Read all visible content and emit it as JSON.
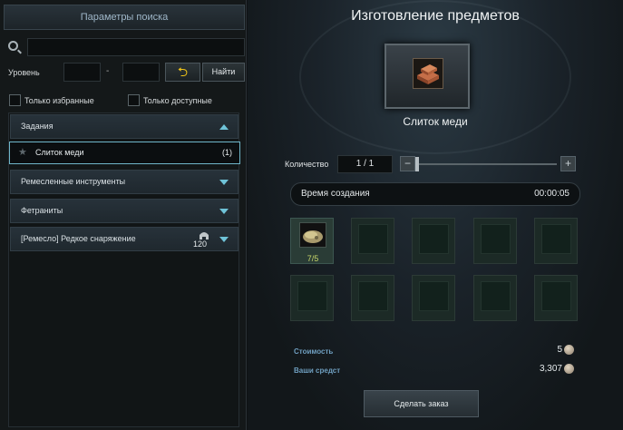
{
  "search_panel": {
    "title": "Параметры поиска",
    "search": {
      "value": "",
      "placeholder": ""
    },
    "level_label": "Уровень",
    "level_separator": "-",
    "level_min": "",
    "level_max": "",
    "find_button": "Найти",
    "only_favorites": "Только избранные",
    "only_available": "Только доступные",
    "categories": [
      {
        "label": "Задания",
        "expanded": true
      },
      {
        "label": "Ремесленные инструменты",
        "expanded": false
      },
      {
        "label": "Фетраниты",
        "expanded": false
      },
      {
        "label": "[Ремесло] Редкое снаряжение",
        "expanded": false,
        "level": "120"
      }
    ],
    "selected_item": {
      "name": "Слиток меди",
      "count": "(1)"
    }
  },
  "crafting": {
    "title": "Изготовление предметов",
    "product_name": "Слиток меди",
    "quantity_label": "Количество",
    "quantity_value": "1 / 1",
    "time_label": "Время создания",
    "time_value": "00:00:05",
    "material_count": "7/5",
    "cost_label": "Стоимость",
    "cost_value": "5",
    "funds_label": "Ваши средст",
    "funds_value": "3,307",
    "order_button": "Сделать заказ"
  },
  "icons": [
    "search-icon",
    "reset-icon",
    "star-icon",
    "chevron-up-icon",
    "chevron-down-icon",
    "helmet-icon",
    "copper-ingot-icon",
    "ore-icon",
    "coin-icon",
    "minus-icon",
    "plus-icon"
  ],
  "colors": {
    "accent": "#6fc3d8",
    "reset_arrow": "#f0c419",
    "count_text": "#c9d86a",
    "label_blue": "#6f9fc0"
  }
}
